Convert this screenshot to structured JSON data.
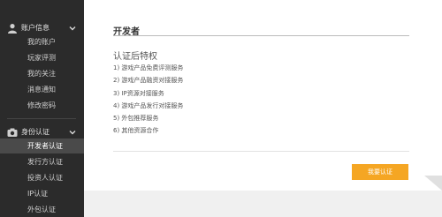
{
  "sidebar": {
    "account_group": {
      "label": "账户信息",
      "icon": "user-icon",
      "items": [
        {
          "label": "我的账户"
        },
        {
          "label": "玩家评测"
        },
        {
          "label": "我的关注"
        },
        {
          "label": "消息通知"
        },
        {
          "label": "修改密码"
        }
      ]
    },
    "auth_group": {
      "label": "身份认证",
      "icon": "id-camera-icon",
      "items": [
        {
          "label": "开发者认证",
          "active": true
        },
        {
          "label": "发行方认证"
        },
        {
          "label": "投资人认证"
        },
        {
          "label": "IP认证"
        },
        {
          "label": "外包认证"
        }
      ]
    }
  },
  "main": {
    "title": "开发者",
    "section_title": "认证后特权",
    "privileges": [
      "1) 游戏产品免费评测服务",
      "2) 游戏产品融资对接服务",
      "3) IP资源对接服务",
      "4) 游戏产品发行对接服务",
      "5) 外包推荐服务",
      "6) 其他资源合作"
    ],
    "apply_button": "我要认证"
  },
  "colors": {
    "sidebar_bg": "#2b2b2b",
    "active_item_bg": "#4a4a4a",
    "accent": "#f5a623"
  }
}
